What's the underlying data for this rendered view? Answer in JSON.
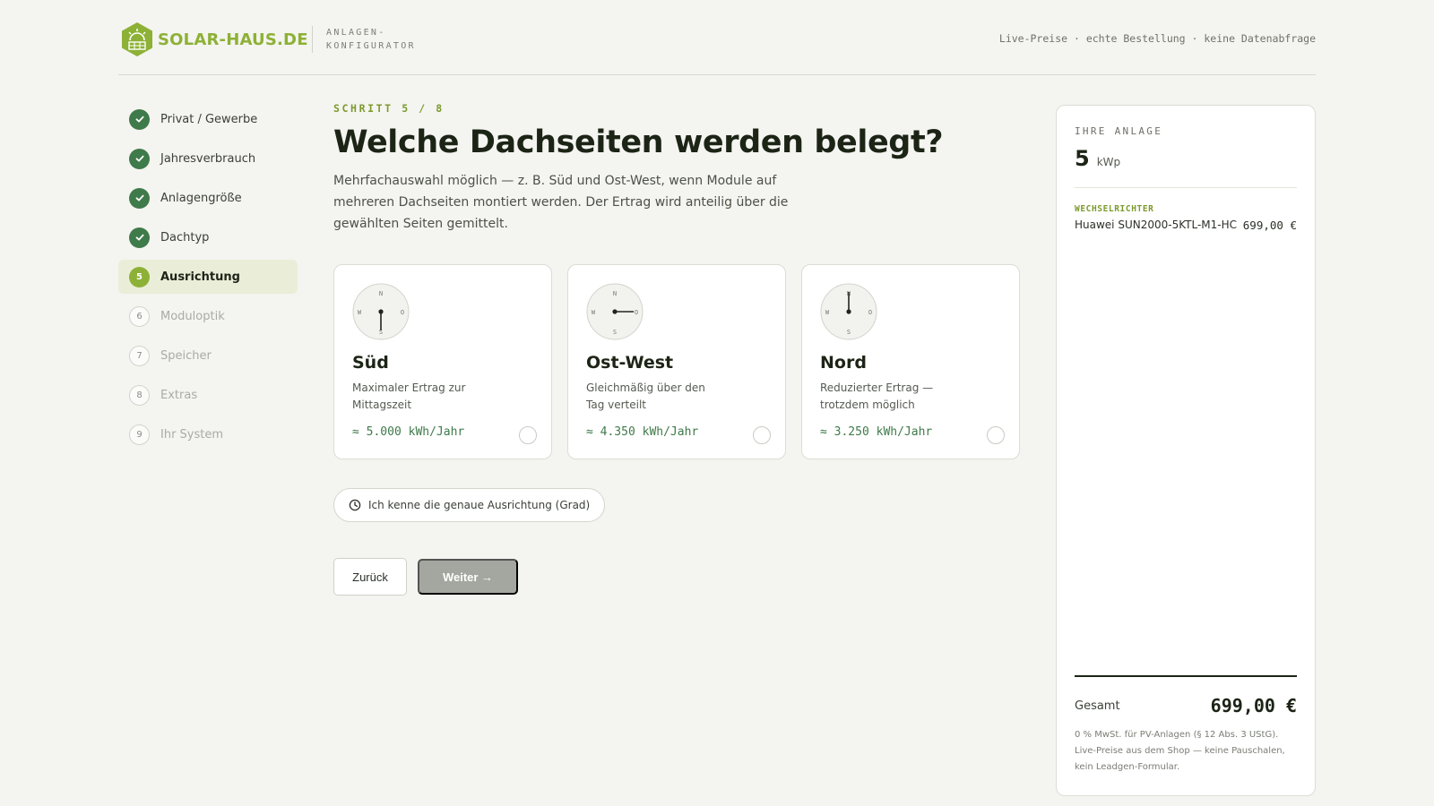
{
  "header": {
    "brand": "SOLAR-HAUS.DE",
    "subtitle": "ANLAGEN-KONFIGURATOR",
    "tagline": "Live-Preise · echte Bestellung · keine Datenabfrage"
  },
  "steps": [
    {
      "num": "1",
      "label": "Privat / Gewerbe",
      "state": "done"
    },
    {
      "num": "2",
      "label": "Jahresverbrauch",
      "state": "done"
    },
    {
      "num": "3",
      "label": "Anlagengröße",
      "state": "done"
    },
    {
      "num": "4",
      "label": "Dachtyp",
      "state": "done"
    },
    {
      "num": "5",
      "label": "Ausrichtung",
      "state": "active"
    },
    {
      "num": "6",
      "label": "Moduloptik",
      "state": "todo"
    },
    {
      "num": "7",
      "label": "Speicher",
      "state": "todo"
    },
    {
      "num": "8",
      "label": "Extras",
      "state": "todo"
    },
    {
      "num": "9",
      "label": "Ihr System",
      "state": "todo"
    }
  ],
  "main": {
    "eyebrow": "SCHRITT 5 / 8",
    "title": "Welche Dachseiten werden belegt?",
    "description": "Mehrfachauswahl möglich — z. B. Süd und Ost-West, wenn Module auf mehreren Dachseiten montiert werden. Der Ertrag wird anteilig über die gewählten Seiten gemittelt.",
    "compass_letters": {
      "n": "N",
      "s": "S",
      "w": "W",
      "o": "O"
    },
    "cards": [
      {
        "title": "Süd",
        "desc": "Maximaler Ertrag zur Mittagszeit",
        "yield": "≈ 5.000 kWh/Jahr",
        "icon": "compass-south-icon"
      },
      {
        "title": "Ost-West",
        "desc": "Gleichmäßig über den Tag verteilt",
        "yield": "≈ 4.350 kWh/Jahr",
        "icon": "compass-east-west-icon"
      },
      {
        "title": "Nord",
        "desc": "Reduzierter Ertrag — trotzdem möglich",
        "yield": "≈ 3.250 kWh/Jahr",
        "icon": "compass-north-icon"
      }
    ],
    "degree_toggle": "Ich kenne die genaue Ausrichtung (Grad)",
    "back_label": "Zurück",
    "next_label": "Weiter →"
  },
  "summary": {
    "heading": "IHRE ANLAGE",
    "kwp_value": "5",
    "kwp_unit": "kWp",
    "inverter_label": "WECHSELRICHTER",
    "inverter_name": "Huawei SUN2000-5KTL-M1-HC",
    "inverter_price": "699,00 €",
    "total_label": "Gesamt",
    "total_value": "699,00 €",
    "note": "0 % MwSt. für PV-Anlagen (§ 12 Abs. 3 UStG). Live-Preise aus dem Shop — keine Pauschalen, kein Leadgen-Formular."
  },
  "colors": {
    "brand_green": "#8db136",
    "done_green": "#3f7a4a",
    "yield_green": "#3f7a4a",
    "disabled_button": "#a4a79f"
  }
}
